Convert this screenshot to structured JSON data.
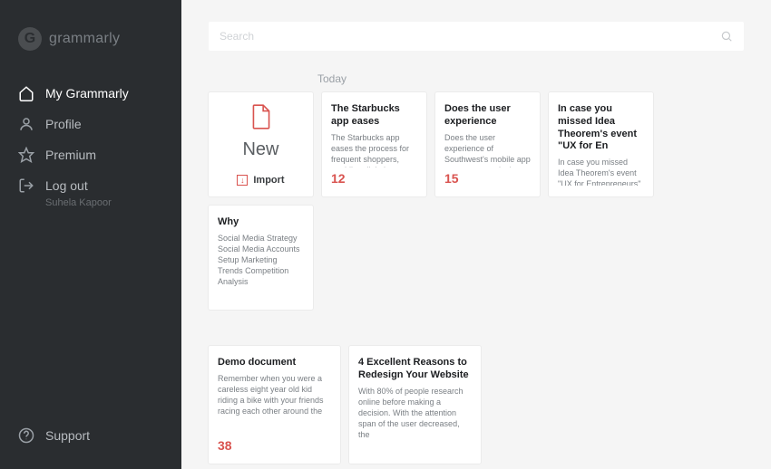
{
  "brand": {
    "name": "grammarly",
    "mark": "G"
  },
  "nav": {
    "my": "My Grammarly",
    "profile": "Profile",
    "premium": "Premium",
    "logout": "Log out",
    "logout_sub": "Suhela Kapoor",
    "support": "Support"
  },
  "search": {
    "placeholder": "Search"
  },
  "section_label": "Today",
  "new_card": {
    "label": "New",
    "import": "Import"
  },
  "cards_row1": [
    {
      "title": "The Starbucks app eases",
      "excerpt": "The Starbucks app eases the process for frequent shoppers, enabling digital payments and tracking",
      "count": "12"
    },
    {
      "title": "Does the user experience",
      "excerpt": "Does the user experience of Southwest's mobile app measure up to its in-flight experience? Let's",
      "count": "15"
    },
    {
      "title": "In case you missed Idea Theorem's event \"UX for En",
      "excerpt": "In case you missed Idea Theorem's event \"UX for Entrepreneurs\" at MaRS last Monday, here is a quick",
      "count": ""
    },
    {
      "title": "Why",
      "excerpt": "Social Media Strategy Social Media Accounts Setup Marketing Trends Competition Analysis",
      "count": ""
    }
  ],
  "cards_row2": [
    {
      "title": "Demo document",
      "excerpt": "Remember when you were a careless eight year old kid riding a bike with your friends racing each other around the",
      "count": "38"
    },
    {
      "title": "4 Excellent Reasons to Redesign Your Website",
      "excerpt": "With 80% of people research online before making a decision. With the attention span of the user decreased, the",
      "count": ""
    }
  ]
}
